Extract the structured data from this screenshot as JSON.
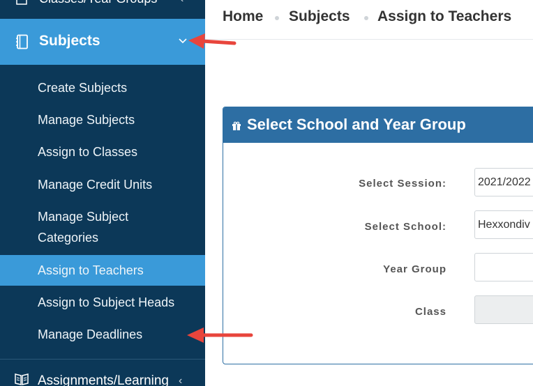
{
  "sidebar": {
    "top_item": {
      "label": "Classes/Year Groups",
      "icon": "users-icon"
    },
    "active_item": {
      "label": "Subjects",
      "icon": "book-icon"
    },
    "sub_items": [
      {
        "label": "Create Subjects"
      },
      {
        "label": "Manage Subjects"
      },
      {
        "label": "Assign to Classes"
      },
      {
        "label": "Manage Credit Units"
      },
      {
        "label": "Manage Subject",
        "label2": "Categories"
      },
      {
        "label": "Assign to Teachers"
      },
      {
        "label": "Assign to Subject Heads"
      },
      {
        "label": "Manage Deadlines"
      }
    ],
    "bottom_item": {
      "label": "Assignments/Learning",
      "icon": "open-book-icon"
    }
  },
  "breadcrumb": [
    "Home",
    "Subjects",
    "Assign to Teachers"
  ],
  "panel": {
    "title": "Select School and Year Group",
    "fields": [
      {
        "label": "Select Session:",
        "value": "2021/2022"
      },
      {
        "label": "Select School:",
        "value": "Hexxondiv"
      },
      {
        "label": "Year Group",
        "value": ""
      },
      {
        "label": "Class",
        "value": ""
      }
    ]
  },
  "colors": {
    "sidebar_bg": "#0c3858",
    "active_bg": "#3a9ad9",
    "panel_header": "#2d6ea3",
    "arrow_red": "#e8453c"
  }
}
